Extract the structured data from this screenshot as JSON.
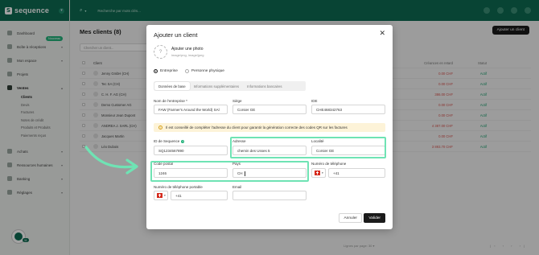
{
  "app": {
    "brand": "sequence",
    "topbar_search_placeholder": "Recherche par mots clés...",
    "main_title": "Mes clients (8)",
    "add_client_label": "Ajouter un client",
    "filter_placeholder": "Chercher un client..."
  },
  "sidebar": {
    "items": [
      {
        "label": "Dashboard"
      },
      {
        "label": "Boîte à réceptions",
        "badge": "Nouveau"
      },
      {
        "label": "Mon espace"
      },
      {
        "label": "Projets"
      },
      {
        "label": "Ventes"
      }
    ],
    "sub_items": [
      "Clients",
      "Devis",
      "Factures",
      "Notes de crédit",
      "Produits et Produits",
      "Paiements reçus"
    ],
    "bottom_items": [
      {
        "label": "Achats"
      },
      {
        "label": "Ressources humaines"
      },
      {
        "label": "Banking"
      },
      {
        "label": "Réglages"
      }
    ],
    "help_count": "11"
  },
  "table": {
    "headers": {
      "client": "Client",
      "amount": "Créances en retard",
      "status": "Statut"
    },
    "rows": [
      {
        "name": "Jenny GmbH (CH)",
        "amount": "0.00 CHF",
        "status": "Actif"
      },
      {
        "name": "Tec SA (CH)",
        "amount": "0.00 CHF",
        "status": "Actif"
      },
      {
        "name": "C. H. F. AG (CH)",
        "amount": "386.00 CHF",
        "status": "Actif"
      },
      {
        "name": "Demo Customer AG",
        "amount": "0.00 CHF",
        "status": "Actif"
      },
      {
        "name": "Monsieur Jean Dupont",
        "amount": "0.00 CHF",
        "status": "Actif"
      },
      {
        "name": "ANDREA J. SARL (CH)",
        "amount": "4 387.00 CHF",
        "status": "Actif"
      },
      {
        "name": "Jacques Martin",
        "amount": "0.00 CHF",
        "status": "Actif"
      },
      {
        "name": "Léo Dubois",
        "amount": "3 893.70 CHF",
        "status": "Actif"
      }
    ],
    "pager_label": "Lignes par page:",
    "pager_value": "30"
  },
  "modal": {
    "title": "Ajouter un client",
    "photo_title": "Ajouter une photo",
    "photo_subtitle": "image/png, image/jpeg",
    "radio_company": "Entreprise",
    "radio_person": "Personne physique",
    "tabs": [
      "Données de base",
      "Informations supplémentaires",
      "Informations bancaires"
    ],
    "fields": {
      "company_name_label": "Nom de l'entreprise *",
      "company_name_value": "FAW (Farmer's Around the World) SAl",
      "seat_label": "Siège",
      "seat_value": "Corsier GE",
      "ide_label": "IDE",
      "ide_value": "CHE468342763",
      "info_text": "Il est conseillé de compléter l'adresse du client pour garantir la génération correcte des codes QR sur les factures",
      "sequence_id_label": "ID de Sequence",
      "sequence_id_value": "SQ1234567890",
      "address_label": "Adresse",
      "address_value": "chemin des Usses 5",
      "locality_label": "Localité",
      "locality_value": "Corsier GE",
      "postal_label": "Code postal",
      "postal_value": "1246",
      "country_label": "Pays",
      "country_value": "CH",
      "phone_label": "Numéro de téléphone",
      "phone_prefix": "+41",
      "mobile_label": "Numéro de téléphone portable",
      "mobile_prefix": "+41",
      "email_label": "Email"
    },
    "cancel_label": "Annuler",
    "save_label": "Valider"
  },
  "colors": {
    "brand": "#0d6b52",
    "highlight": "#6fe3b4",
    "info_bg": "#fdf3d8"
  }
}
